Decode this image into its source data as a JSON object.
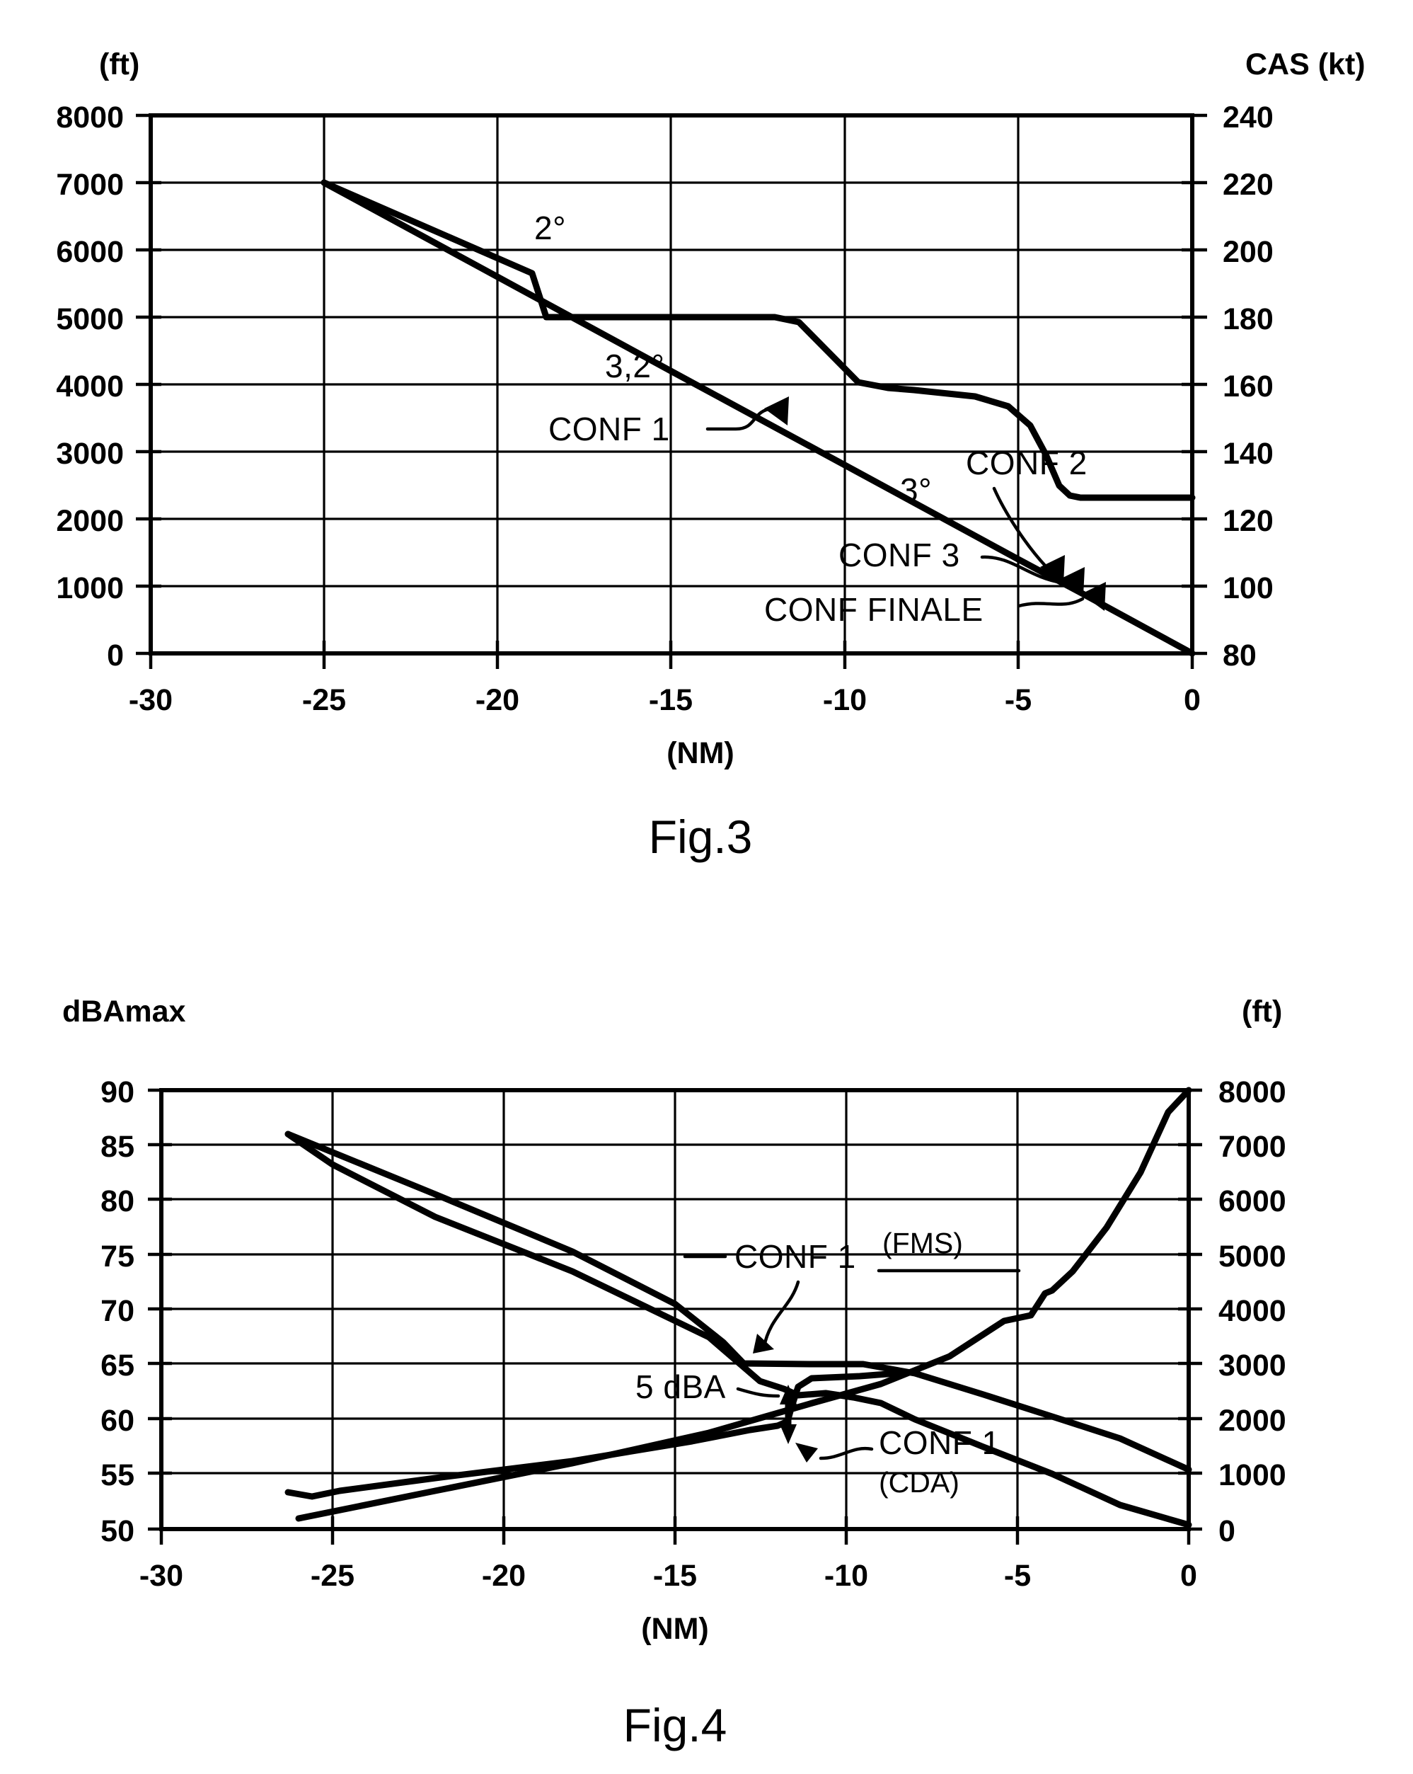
{
  "document": {
    "type": "patent-figure-sheet",
    "figures": [
      "Fig.3",
      "Fig.4"
    ]
  },
  "fig3": {
    "caption": "Fig.3",
    "left_axis": {
      "unit_label": "(ft)",
      "ticks": [
        "8000",
        "7000",
        "6000",
        "5000",
        "4000",
        "3000",
        "2000",
        "1000",
        "0"
      ]
    },
    "right_axis": {
      "unit_label": "CAS (kt)",
      "ticks": [
        "240",
        "220",
        "200",
        "180",
        "160",
        "140",
        "120",
        "100",
        "80"
      ]
    },
    "x_axis": {
      "unit_label": "(NM)",
      "ticks": [
        "-30",
        "-25",
        "-20",
        "-15",
        "-10",
        "-5",
        "0"
      ]
    },
    "annotations": [
      {
        "id": "slope-2deg",
        "text": "2°"
      },
      {
        "id": "slope-32deg",
        "text": "3,2°"
      },
      {
        "id": "slope-3deg",
        "text": "3°"
      },
      {
        "id": "conf-1",
        "text": "CONF 1"
      },
      {
        "id": "conf-2",
        "text": "CONF 2"
      },
      {
        "id": "conf-3",
        "text": "CONF 3"
      },
      {
        "id": "conf-finale",
        "text": "CONF FINALE"
      }
    ],
    "chart_data": {
      "type": "line",
      "title": "Fig.3",
      "xlabel": "(NM)",
      "ylabel": "(ft)",
      "y2label": "CAS (kt)",
      "xlim": [
        -30,
        0
      ],
      "ylim": [
        0,
        8000
      ],
      "y2lim": [
        80,
        240
      ],
      "grid": true,
      "legend": "none",
      "series": [
        {
          "name": "altitude-profile-3.2deg",
          "axis": "left",
          "unit": "ft",
          "x": [
            -25.0,
            -20.0,
            -15.0,
            -10.0,
            -5.0,
            -3.2,
            0.0
          ],
          "y": [
            7000,
            5600,
            4200,
            2800,
            1400,
            900,
            0
          ]
        },
        {
          "name": "altitude-profile-2deg-then-level",
          "axis": "left",
          "unit": "ft",
          "x": [
            -25.0,
            -22.0,
            -19.0,
            -18.6,
            -12.0,
            -9.6,
            -8.0,
            -5.2,
            -4.2,
            -3.4,
            -3.0,
            0.0
          ],
          "y": [
            7000,
            6330,
            5400,
            5000,
            5000,
            4000,
            3900,
            3700,
            3400,
            2600,
            2380,
            2380
          ]
        }
      ],
      "speed_profile": {
        "name": "cas-profile",
        "axis": "right",
        "unit": "kt",
        "x": [
          -25.0,
          -18.6,
          -12.0,
          -9.6,
          -5.2,
          -4.2,
          -3.4,
          -3.0,
          0.0
        ],
        "y": [
          220,
          180,
          180,
          160,
          154,
          148,
          132,
          128,
          128
        ]
      },
      "markers": [
        {
          "label": "CONF 1",
          "x": -12.6,
          "y_ft": 3750
        },
        {
          "label": "CONF 2",
          "x": -4.6,
          "y_ft": 1450
        },
        {
          "label": "CONF 3",
          "x": -4.0,
          "y_ft": 1300
        },
        {
          "label": "CONF FINALE",
          "x": -3.4,
          "y_ft": 1050
        }
      ],
      "slope_labels": [
        {
          "text": "2°",
          "x": -18.0,
          "y_ft": 6150
        },
        {
          "text": "3,2°",
          "x": -16.5,
          "y_ft": 4350
        },
        {
          "text": "3°",
          "x": -6.5,
          "y_ft": 2400
        }
      ]
    }
  },
  "fig4": {
    "caption": "Fig.4",
    "left_axis": {
      "unit_label": "dBAmax",
      "ticks": [
        "90",
        "85",
        "80",
        "75",
        "70",
        "65",
        "60",
        "55",
        "50"
      ]
    },
    "right_axis": {
      "unit_label": "(ft)",
      "ticks": [
        "8000",
        "7000",
        "6000",
        "5000",
        "4000",
        "3000",
        "2000",
        "1000",
        "0"
      ]
    },
    "x_axis": {
      "unit_label": "(NM)",
      "ticks": [
        "-30",
        "-25",
        "-20",
        "-15",
        "-10",
        "-5",
        "0"
      ]
    },
    "annotations": [
      {
        "id": "conf-1-fms-main",
        "text": "CONF 1"
      },
      {
        "id": "conf-1-fms-sub",
        "text": "(FMS)"
      },
      {
        "id": "delta-5dba",
        "text": "5 dBA"
      },
      {
        "id": "conf-1-cda-main",
        "text": "CONF 1"
      },
      {
        "id": "conf-1-cda-sub",
        "text": "(CDA)"
      }
    ],
    "chart_data": {
      "type": "line",
      "title": "Fig.4",
      "xlabel": "(NM)",
      "ylabel": "dBAmax",
      "y2label": "(ft)",
      "xlim": [
        -30,
        0
      ],
      "ylim": [
        50,
        90
      ],
      "y2lim": [
        0,
        8000
      ],
      "grid": true,
      "legend": "none",
      "series": [
        {
          "name": "noise-fms",
          "axis": "left",
          "unit": "dBAmax",
          "x": [
            -26.3,
            -22.0,
            -18.0,
            -15.0,
            -13.6,
            -13.0,
            -11.0,
            -9.5,
            -8.0,
            -6.0,
            -4.0,
            -2.0,
            0.0
          ],
          "y": [
            86.0,
            80.5,
            75.3,
            70.5,
            67.0,
            65.2,
            65.0,
            65.0,
            64.2,
            62.0,
            59.3,
            56.2,
            53.0
          ]
        },
        {
          "name": "noise-cda",
          "axis": "left",
          "unit": "dBAmax",
          "x": [
            -26.3,
            -25.0,
            -22.0,
            -18.0,
            -14.0,
            -12.5,
            -11.8,
            -11.4,
            -10.6,
            -9.8,
            -9.0,
            -8.0,
            -6.0,
            -4.0,
            -2.0,
            0.0
          ],
          "y": [
            86.0,
            83.2,
            78.5,
            73.5,
            67.5,
            63.5,
            62.8,
            62.2,
            62.4,
            62.0,
            61.5,
            60.0,
            57.5,
            55.0,
            52.7,
            50.8
          ]
        },
        {
          "name": "ground-track-low-cda",
          "axis": "left",
          "unit": "dBAmax",
          "x": [
            -26.3,
            -25.6,
            -24.8,
            -22.0,
            -18.0,
            -14.5,
            -12.8,
            -12.0,
            -11.7,
            -11.6,
            -11.4,
            -11.0,
            -9.6,
            -8.0
          ],
          "y": [
            51.4,
            51.0,
            51.5,
            52.6,
            54.2,
            56.0,
            57.0,
            57.4,
            57.8,
            59.0,
            61.0,
            61.8,
            62.0,
            62.4
          ]
        },
        {
          "name": "altitude-profile",
          "axis": "right",
          "unit": "ft",
          "x": [
            -26.0,
            -22.0,
            -18.0,
            -14.0,
            -11.0,
            -9.0,
            -7.0,
            -5.4,
            -4.6,
            -4.2,
            -4.0,
            -3.4,
            -2.4,
            -1.4,
            -0.6,
            0.0
          ],
          "y": [
            200,
            700,
            1200,
            1750,
            2300,
            2650,
            3150,
            3800,
            3900,
            4300,
            4350,
            4700,
            5500,
            6500,
            7600,
            8000
          ]
        }
      ],
      "annotations_data": [
        {
          "text": "CONF 1 (FMS)",
          "points_to_x": -11.7,
          "points_to_y_dba": 65.0
        },
        {
          "text": "5 dBA",
          "delta_value": 5,
          "at_x": -11.8,
          "between_dba": [
            57.4,
            62.5
          ]
        },
        {
          "text": "CONF 1 (CDA)",
          "points_to_x": -11.4,
          "points_to_y_dba": 57.8
        }
      ]
    }
  }
}
